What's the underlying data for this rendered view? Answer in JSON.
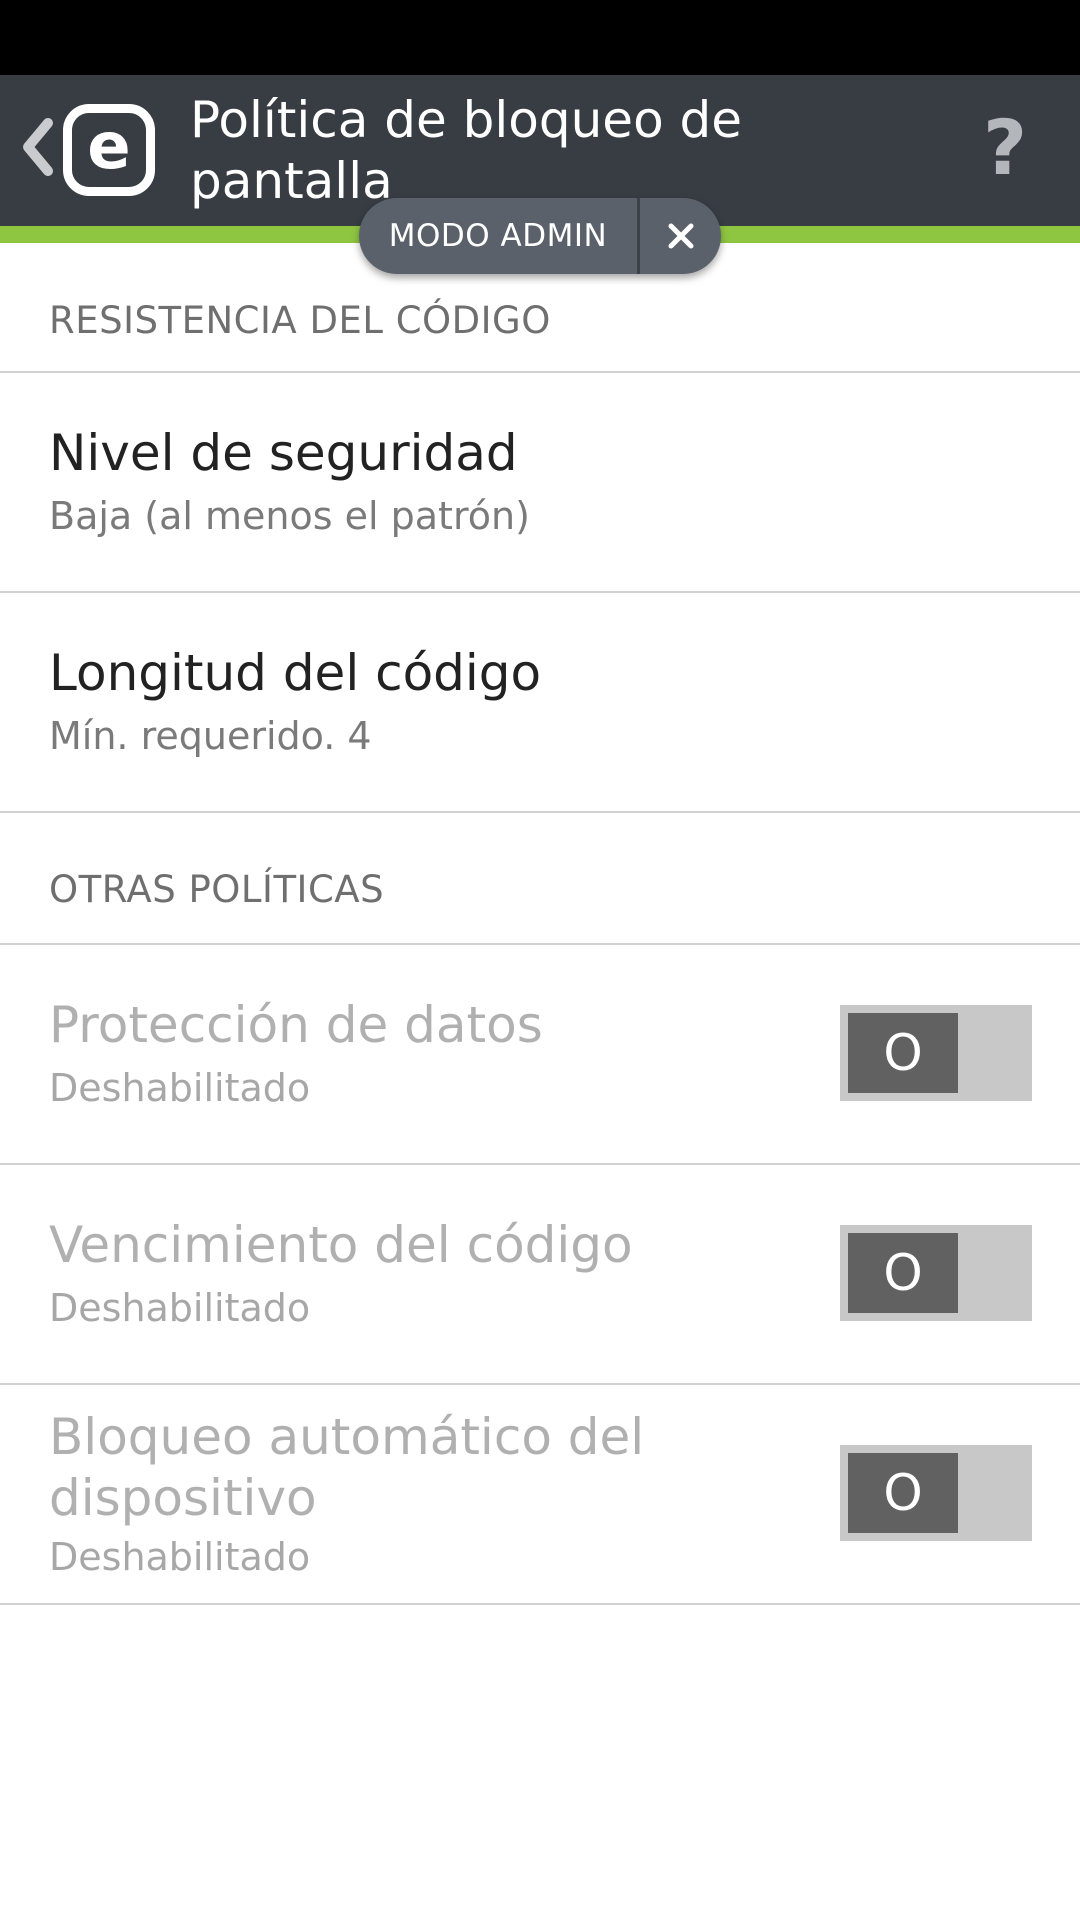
{
  "header": {
    "title": "Política de bloqueo de pantalla",
    "logo_letter": "e",
    "help_glyph": "?"
  },
  "admin_mode": {
    "label": "MODO ADMIN"
  },
  "sections": [
    {
      "header": "RESISTENCIA DEL CÓDIGO",
      "items": [
        {
          "title": "Nivel de seguridad",
          "subtitle": "Baja (al menos el patrón)"
        },
        {
          "title": "Longitud del código",
          "subtitle": "Mín. requerido. 4"
        }
      ]
    },
    {
      "header": "OTRAS POLÍTICAS",
      "items": [
        {
          "title": "Protección de datos",
          "subtitle": "Deshabilitado",
          "toggle": "O"
        },
        {
          "title": "Vencimiento del código",
          "subtitle": "Deshabilitado",
          "toggle": "O"
        },
        {
          "title": "Bloqueo automático del dispositivo",
          "subtitle": "Deshabilitado",
          "toggle": "O"
        }
      ]
    }
  ],
  "colors": {
    "action_bar": "#383d43",
    "accent_green": "#8ec641",
    "pill": "#5b616a"
  }
}
